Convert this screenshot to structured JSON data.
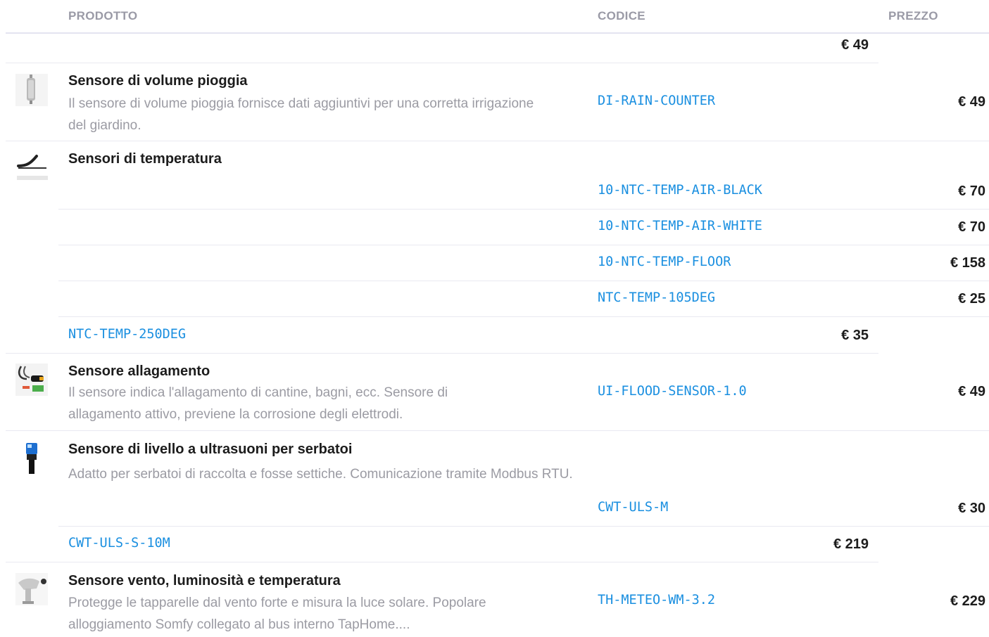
{
  "header": {
    "product": "PRODOTTO",
    "code": "CODICE",
    "price": "PREZZO"
  },
  "rows": {
    "top_price": "€ 49",
    "rain": {
      "title": "Sensore di volume pioggia",
      "desc": "Il sensore di volume pioggia fornisce dati aggiuntivi per una corretta irrigazione del giardino.",
      "code": "DI-RAIN-COUNTER",
      "price": "€ 49",
      "icon": "rain-counter-icon"
    },
    "temp": {
      "title": "Sensori di temperatura",
      "icon": "temperature-probe-icon",
      "variants": [
        {
          "code": "10-NTC-TEMP-AIR-BLACK",
          "price": "€ 70"
        },
        {
          "code": "10-NTC-TEMP-AIR-WHITE",
          "price": "€ 70"
        },
        {
          "code": "10-NTC-TEMP-FLOOR",
          "price": "€ 158"
        },
        {
          "code": "NTC-TEMP-105DEG",
          "price": "€ 25"
        },
        {
          "code": "NTC-TEMP-250DEG",
          "price": "€ 35"
        }
      ]
    },
    "flood": {
      "title": "Sensore allagamento",
      "desc": "Il sensore indica l'allagamento di cantine, bagni, ecc. Sensore di allagamento attivo, previene la corrosione degli elettrodi.",
      "code": "UI-FLOOD-SENSOR-1.0",
      "price": "€ 49",
      "icon": "flood-sensor-icon"
    },
    "ultrasonic": {
      "title": "Sensore di livello a ultrasuoni per serbatoi",
      "desc": "Adatto per serbatoi di raccolta e fosse settiche. Comunicazione tramite Modbus RTU.",
      "icon": "ultrasonic-sensor-icon",
      "variants": [
        {
          "code": "CWT-ULS-M",
          "price": "€ 30"
        },
        {
          "code": "CWT-ULS-S-10M",
          "price": "€ 219"
        }
      ]
    },
    "meteo": {
      "title": "Sensore vento, luminosità e temperatura",
      "desc": "Protegge le tapparelle dal vento forte e misura la luce solare. Popolare alloggiamento Somfy collegato al bus interno TapHome....",
      "code": "TH-METEO-WM-3.2",
      "price": "€ 229",
      "icon": "weather-station-icon"
    }
  }
}
